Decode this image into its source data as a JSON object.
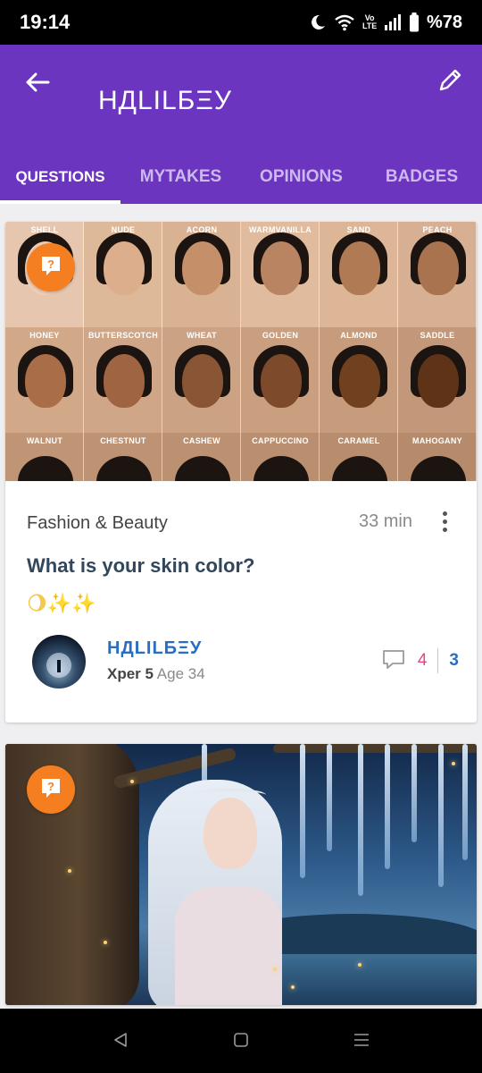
{
  "status_bar": {
    "time": "19:14",
    "volte_label": "Vo LTE",
    "battery": "%78"
  },
  "header": {
    "profile_name": "НДLILБΞУ",
    "back_icon": "arrow-left-icon",
    "edit_icon": "pencil-icon"
  },
  "tabs": [
    {
      "label": "QUESTIONS",
      "active": true
    },
    {
      "label": "MYTAKES",
      "active": false
    },
    {
      "label": "OPINIONS",
      "active": false
    },
    {
      "label": "BADGES",
      "active": false
    }
  ],
  "colors": {
    "header_bg": "#6c35c0",
    "badge_orange": "#f57f20",
    "author_blue": "#2a6ec4",
    "comment_pink": "#e0488a"
  },
  "posts": [
    {
      "image": {
        "top_labels": [
          "SHELL",
          "NUDE",
          "ACORN",
          "WARMVANILLA",
          "SAND",
          "PEACH"
        ],
        "middle_labels": [
          "HONEY",
          "BUTTERSCOTCH",
          "WHEAT",
          "GOLDEN",
          "ALMOND",
          "SADDLE"
        ],
        "bottom_labels": [
          "WALNUT",
          "CHESTNUT",
          "CASHEW",
          "CAPPUCCINO",
          "CARAMEL",
          "MAHOGANY"
        ]
      },
      "category": "Fashion & Beauty",
      "time_ago": "33 min",
      "title": "What is your skin color?",
      "emoji": "🌖✨✨",
      "author": "НДLILБΞУ",
      "xper": "Xper 5",
      "age": "Age 34",
      "comments": "4",
      "opinions": "3"
    }
  ]
}
